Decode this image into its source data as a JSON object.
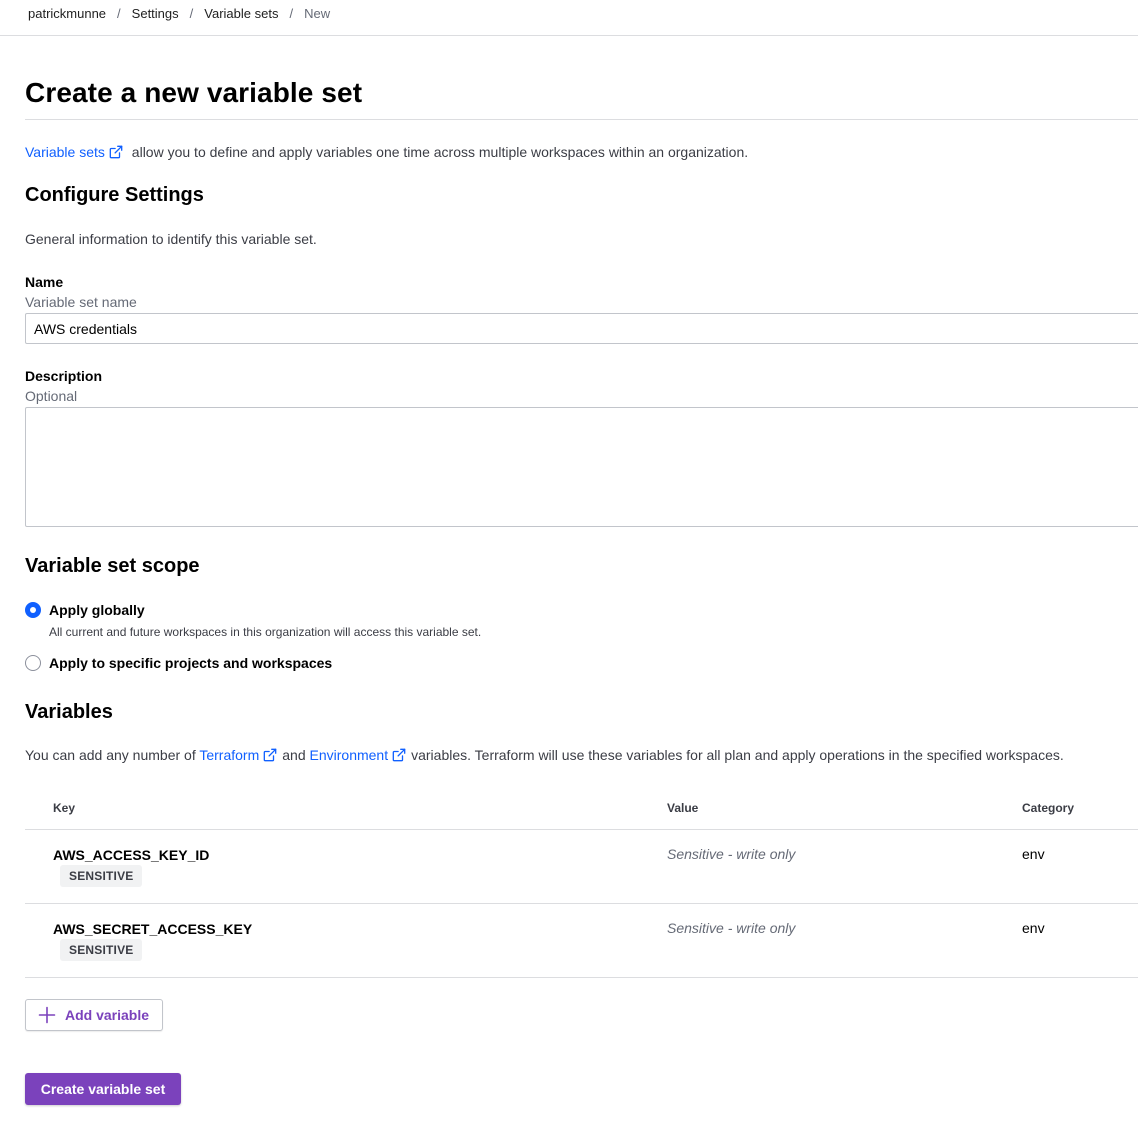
{
  "breadcrumb": {
    "items": [
      "patrickmunne",
      "Settings",
      "Variable sets",
      "New"
    ],
    "separator": "/"
  },
  "page": {
    "title": "Create a new variable set"
  },
  "intro": {
    "link_text": "Variable sets",
    "text": "allow you to define and apply variables one time across multiple workspaces within an organization."
  },
  "settings": {
    "heading": "Configure Settings",
    "help": "General information to identify this variable set.",
    "name_label": "Name",
    "name_hint": "Variable set name",
    "name_value": "AWS credentials",
    "description_label": "Description",
    "description_hint": "Optional",
    "description_value": ""
  },
  "scope": {
    "heading": "Variable set scope",
    "options": [
      {
        "label": "Apply globally",
        "help": "All current and future workspaces in this organization will access this variable set.",
        "selected": true
      },
      {
        "label": "Apply to specific projects and workspaces",
        "help": "",
        "selected": false
      }
    ]
  },
  "variables": {
    "heading": "Variables",
    "help_prefix": "You can add any number of",
    "link_terraform": "Terraform",
    "help_and": "and",
    "link_environment": "Environment",
    "help_suffix": "variables. Terraform will use these variables for all plan and apply operations in the specified workspaces.",
    "columns": [
      "Key",
      "Value",
      "Category"
    ],
    "rows": [
      {
        "key": "AWS_ACCESS_KEY_ID",
        "badge": "SENSITIVE",
        "value": "Sensitive - write only",
        "category": "env"
      },
      {
        "key": "AWS_SECRET_ACCESS_KEY",
        "badge": "SENSITIVE",
        "value": "Sensitive - write only",
        "category": "env"
      }
    ],
    "add_button": "Add variable"
  },
  "submit_button": "Create variable set",
  "colors": {
    "link": "#1060ff",
    "brand_purple": "#7b42bc",
    "radio_selected": "#1060ff",
    "border": "#c2c5cb",
    "divider": "#dcdde0"
  },
  "icons": {
    "external_link": "external-link-icon",
    "plus": "plus-icon"
  }
}
